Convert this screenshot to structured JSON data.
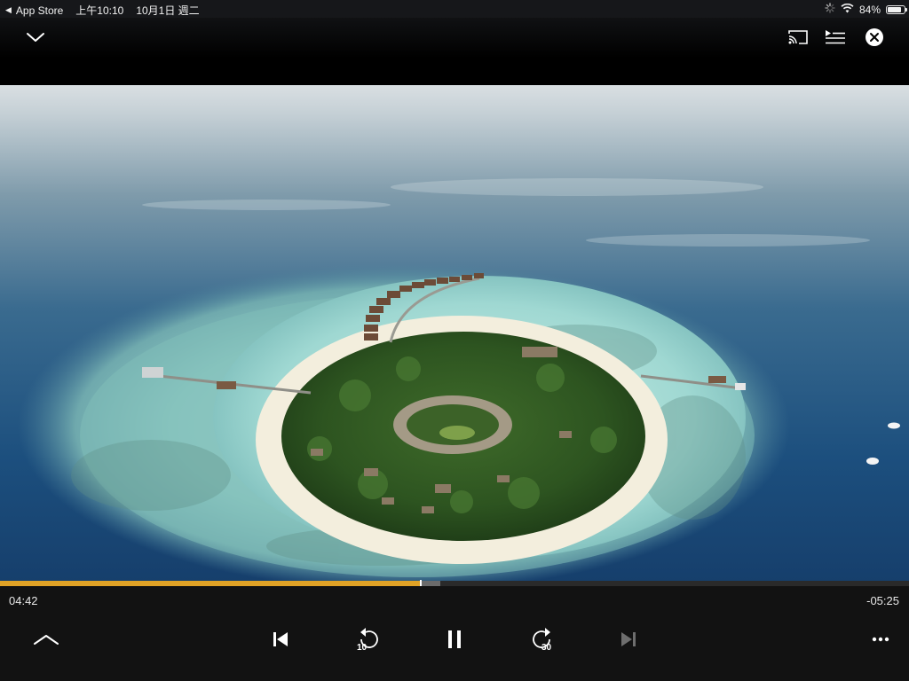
{
  "status_bar": {
    "back_app": "App Store",
    "time": "上午10:10",
    "date": "10月1日 週二",
    "battery_percent": "84%",
    "battery_level": 0.84,
    "icons": [
      "back-arrow-icon",
      "activity-spinner-icon",
      "wifi-icon",
      "battery-icon"
    ]
  },
  "top_bar": {
    "buttons": [
      "chevron-down-icon",
      "cast-icon",
      "queue-icon",
      "close-icon"
    ]
  },
  "video": {
    "content": "aerial island resort"
  },
  "playback": {
    "elapsed": "04:42",
    "remaining": "-05:25",
    "progress_fraction": 0.463,
    "buffered_fraction": 0.484
  },
  "controls": {
    "rewind_seconds": "10",
    "forward_seconds": "30",
    "state": "playing"
  },
  "colors": {
    "accent": "#e0a226",
    "background": "#121212"
  }
}
